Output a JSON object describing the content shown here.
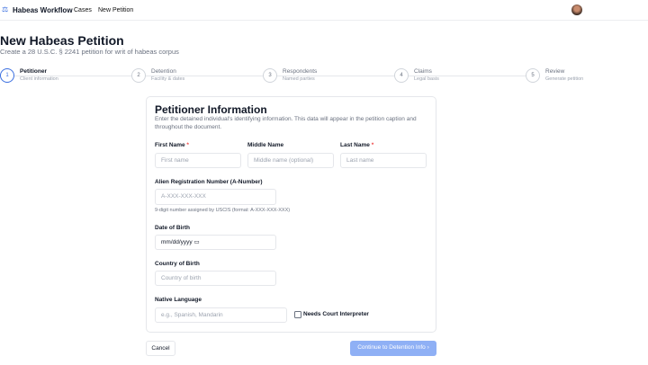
{
  "header": {
    "brand": "Habeas Workflow",
    "nav": [
      "Cases",
      "New Petition"
    ]
  },
  "page": {
    "title": "New Habeas Petition",
    "subtitle": "Create a 28 U.S.C. § 2241 petition for writ of habeas corpus"
  },
  "steps": [
    {
      "num": "1",
      "title": "Petitioner",
      "desc": "Client information",
      "active": true
    },
    {
      "num": "2",
      "title": "Detention",
      "desc": "Facility & dates"
    },
    {
      "num": "3",
      "title": "Respondents",
      "desc": "Named parties"
    },
    {
      "num": "4",
      "title": "Claims",
      "desc": "Legal basis"
    },
    {
      "num": "5",
      "title": "Review",
      "desc": "Generate petition"
    }
  ],
  "form": {
    "title": "Petitioner Information",
    "desc": "Enter the detained individual's identifying information. This data will appear in the petition caption and throughout the document.",
    "first_label": "First Name",
    "first_ph": "First name",
    "middle_label": "Middle Name",
    "middle_ph": "Middle name (optional)",
    "last_label": "Last Name",
    "last_ph": "Last name",
    "required_mark": "*",
    "anum_label": "Alien Registration Number (A-Number)",
    "anum_ph": "A-XXX-XXX-XXX",
    "anum_hint": "9-digit number assigned by USCIS (format: A-XXX-XXX-XXX)",
    "dob_label": "Date of Birth",
    "dob_ph": "mm/dd/yyyy",
    "country_label": "Country of Birth",
    "country_ph": "Country of birth",
    "lang_label": "Native Language",
    "lang_ph": "e.g., Spanish, Mandarin",
    "interp_label": "Needs Court Interpreter",
    "interp_checked": false
  },
  "actions": {
    "cancel": "Cancel",
    "continue": "Continue to Detention Info",
    "continue_color": "#8fb0f5"
  }
}
